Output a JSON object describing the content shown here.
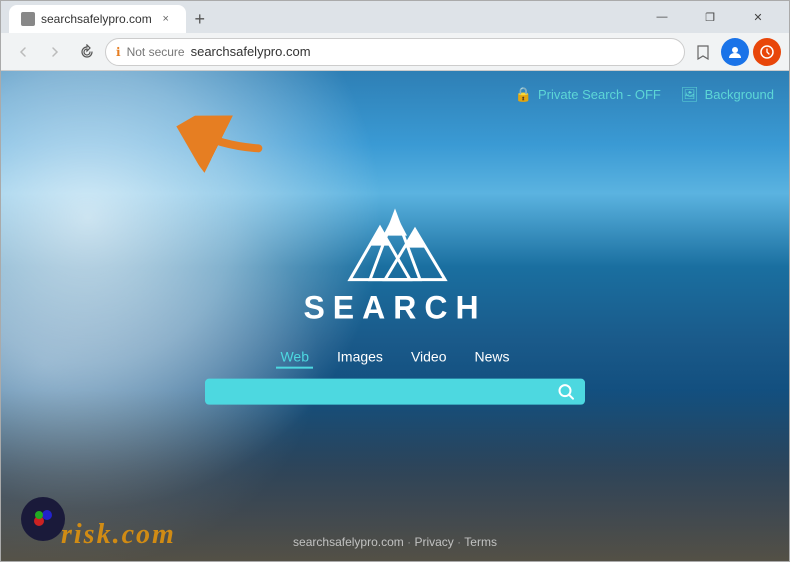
{
  "browser": {
    "tab": {
      "favicon_alt": "site-favicon",
      "label": "searchsafelypro.com",
      "close_label": "×"
    },
    "new_tab_label": "+",
    "window_controls": {
      "minimize": "—",
      "restore": "❐",
      "close": "✕"
    },
    "address_bar": {
      "back_icon": "‹",
      "forward_icon": "›",
      "refresh_icon": "↻",
      "security_label": "Not secure",
      "url": "searchsafelypro.com",
      "bookmark_icon": "☆",
      "profile_icon": "👤",
      "update_icon": "●"
    }
  },
  "page": {
    "top_nav": {
      "private_search_icon": "🔒",
      "private_search_label": "Private Search - OFF",
      "background_icon": "🖼",
      "background_label": "Background"
    },
    "logo_text": "SEARCH",
    "search_tabs": [
      {
        "label": "Web",
        "active": true
      },
      {
        "label": "Images",
        "active": false
      },
      {
        "label": "Video",
        "active": false
      },
      {
        "label": "News",
        "active": false
      }
    ],
    "search_placeholder": "",
    "search_icon": "🔍",
    "footer_links": [
      {
        "label": "searchsafelypro.com"
      },
      {
        "sep": "·"
      },
      {
        "label": "Privacy"
      },
      {
        "sep": "·"
      },
      {
        "label": "Terms"
      }
    ],
    "risk_watermark": "risk.com",
    "annotation_arrow": "➜"
  }
}
